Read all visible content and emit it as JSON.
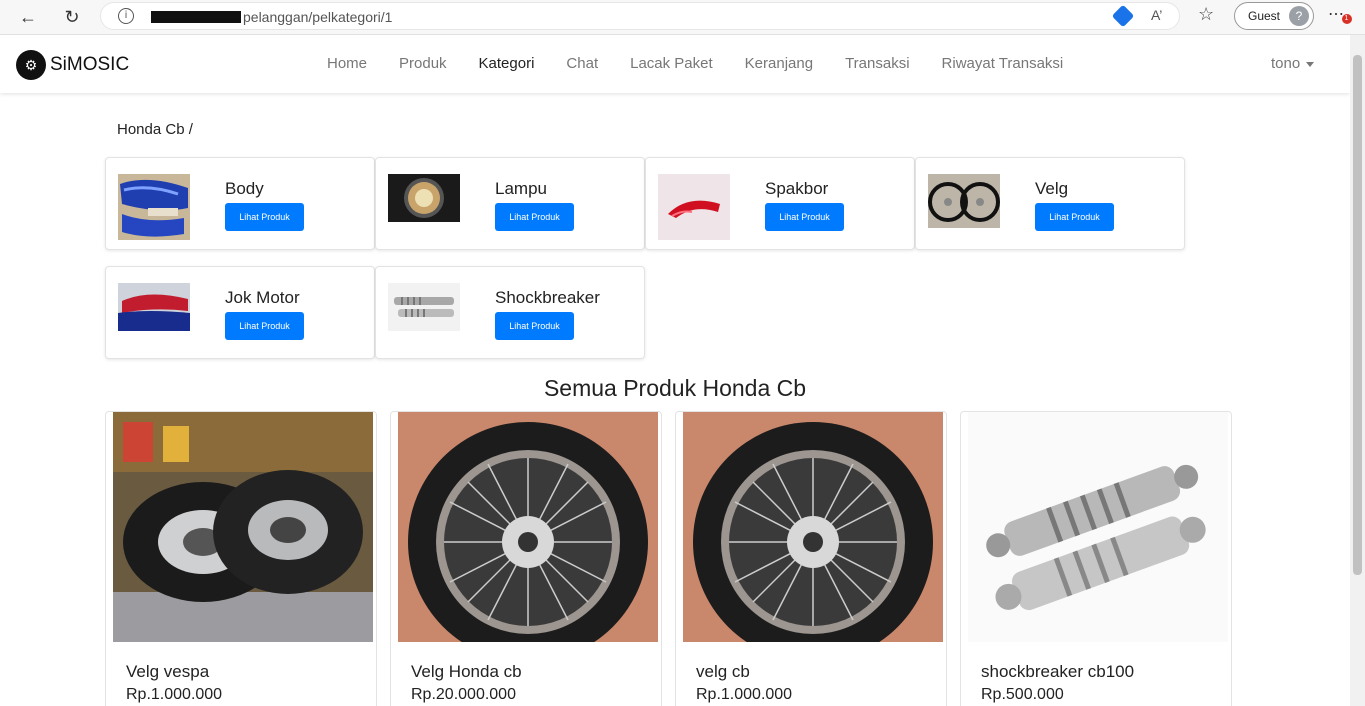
{
  "browser": {
    "url_visible": "pelanggan/pelkategori/1",
    "profile_label": "Guest"
  },
  "navbar": {
    "brand": "SiMOSIC",
    "items": [
      {
        "label": "Home"
      },
      {
        "label": "Produk"
      },
      {
        "label": "Kategori"
      },
      {
        "label": "Chat"
      },
      {
        "label": "Lacak Paket"
      },
      {
        "label": "Keranjang"
      },
      {
        "label": "Transaksi"
      },
      {
        "label": "Riwayat Transaksi"
      }
    ],
    "active": "Kategori",
    "user": "tono"
  },
  "breadcrumb": "Honda Cb /",
  "categories": [
    {
      "name": "Body",
      "button": "Lihat Produk"
    },
    {
      "name": "Lampu",
      "button": "Lihat Produk"
    },
    {
      "name": "Spakbor",
      "button": "Lihat Produk"
    },
    {
      "name": "Velg",
      "button": "Lihat Produk"
    },
    {
      "name": "Jok Motor",
      "button": "Lihat Produk"
    },
    {
      "name": "Shockbreaker",
      "button": "Lihat Produk"
    }
  ],
  "section_title": "Semua Produk Honda Cb",
  "products": [
    {
      "name": "Velg vespa",
      "price": "Rp.1.000.000"
    },
    {
      "name": "Velg Honda cb",
      "price": "Rp.20.000.000"
    },
    {
      "name": "velg cb",
      "price": "Rp.1.000.000"
    },
    {
      "name": "shockbreaker cb100",
      "price": "Rp.500.000"
    }
  ],
  "colors": {
    "primary": "#007bff"
  }
}
